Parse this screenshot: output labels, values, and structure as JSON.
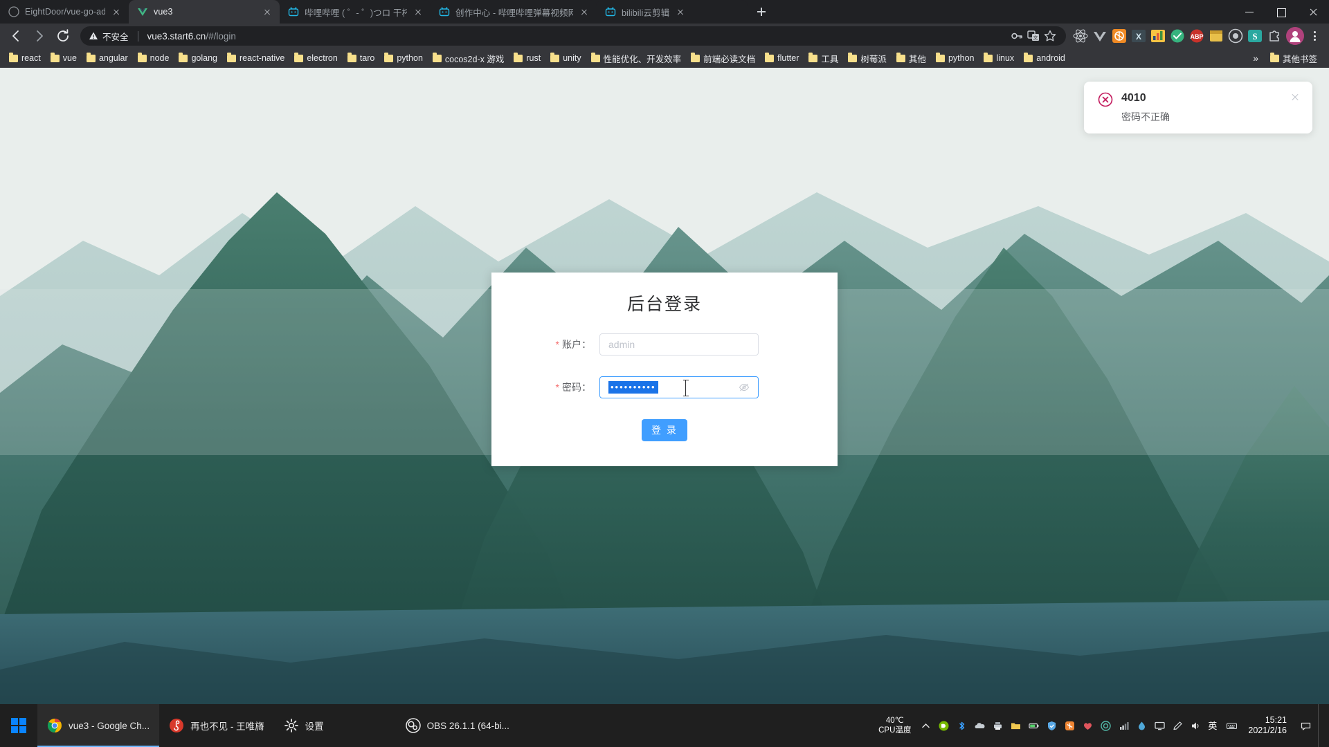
{
  "browser": {
    "tabs": [
      {
        "title": "EightDoor/vue-go-admin: vue",
        "favicon": "github-icon",
        "active": false
      },
      {
        "title": "vue3",
        "favicon": "vue-icon",
        "active": true
      },
      {
        "title": "哔哩哔哩 ( ゜- ゜)つロ 干杯~-bili",
        "favicon": "bilibili-icon",
        "active": false
      },
      {
        "title": "创作中心 - 哔哩哔哩弹幕视频网",
        "favicon": "bilibili-icon",
        "active": false
      },
      {
        "title": "bilibili云剪辑",
        "favicon": "bilibili-icon",
        "active": false
      }
    ],
    "new_tab_label": "+",
    "window_controls": {
      "minimize": "—",
      "maximize": "□",
      "close": "✕"
    },
    "toolbar": {
      "back": "←",
      "forward": "→",
      "reload": "⟳",
      "security_label": "不安全",
      "url_host": "vue3.start6.cn",
      "url_path": "/#/login",
      "omnibox_icons": [
        "key-icon",
        "translate-icon",
        "bookmark-star-icon"
      ],
      "extension_icons": [
        "react-devtools-icon",
        "vue-devtools-icon",
        "orange-ext-icon",
        "x-ext-icon",
        "chart-ext-icon",
        "abp-icon",
        "box-ext-icon",
        "shield-ext-icon",
        "s-ext-icon",
        "green-ext-icon"
      ],
      "profile_avatar": "user-avatar",
      "menu": "⋮"
    },
    "bookmarks": [
      "react",
      "vue",
      "angular",
      "node",
      "golang",
      "react-native",
      "electron",
      "taro",
      "python",
      "cocos2d-x 游戏",
      "rust",
      "unity",
      "性能优化、开发效率",
      "前端必读文档",
      "flutter",
      "工具",
      "树莓派",
      "其他",
      "python",
      "linux",
      "android"
    ],
    "bookmarks_overflow": "»",
    "bookmarks_other": "其他书签"
  },
  "page": {
    "login_card": {
      "title": "后台登录",
      "fields": [
        {
          "required": "*",
          "label": "账户：",
          "value": "",
          "placeholder": "admin",
          "focused": false
        },
        {
          "required": "*",
          "label": "密码：",
          "value": "••••••••••",
          "placeholder": "",
          "focused": true
        }
      ],
      "password_toggle_icon": "eye-slash-icon",
      "submit_label": "登 录",
      "accent_color": "#409eff"
    },
    "toast": {
      "icon": "error-circle-icon",
      "title": "4010",
      "message": "密码不正确",
      "close_icon": "close-icon",
      "error_color": "#c2185b"
    }
  },
  "taskbar": {
    "start_icon": "windows-logo-icon",
    "items": [
      {
        "icon": "chrome-icon",
        "label": "vue3 - Google Ch...",
        "active": true
      },
      {
        "icon": "netease-music-icon",
        "label": "再也不见 - 王唯旖",
        "active": false
      },
      {
        "icon": "gear-icon",
        "label": "设置",
        "active": false
      },
      {
        "icon": "obs-icon",
        "label": "OBS 26.1.1 (64-bi...",
        "active": false
      }
    ],
    "cpu_temp_value": "40℃",
    "cpu_temp_label": "CPU温度",
    "tray_icons": [
      "chevron-up-icon",
      "nvidia-icon",
      "bluetooth-icon",
      "onedrive-icon",
      "printer-icon",
      "folder-icon",
      "battery-icon",
      "shield-icon",
      "orange-icon",
      "heart-icon",
      "spiral-icon",
      "network-icon",
      "droplet-icon",
      "monitor-icon",
      "pen-icon",
      "volume-icon"
    ],
    "ime_label": "英",
    "ime_icon": "keyboard-icon",
    "clock_time": "15:21",
    "clock_date": "2021/2/16",
    "notification_icon": "notification-icon"
  }
}
